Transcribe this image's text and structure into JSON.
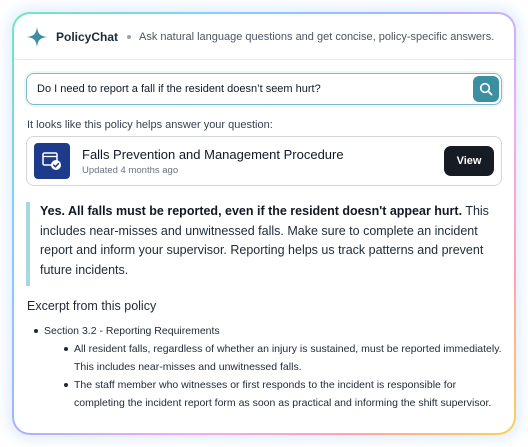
{
  "app": {
    "name": "PolicyChat",
    "tagline": "Ask natural language questions and get concise, policy-specific answers.",
    "logo_icon": "sparkle-icon",
    "colors": {
      "accent": "#3b8fa0",
      "doc_icon_bg": "#1e3a8a",
      "view_button_bg": "#171b24",
      "answer_bar": "#a5d8e0"
    }
  },
  "search": {
    "value": "Do I need to report a fall if the resident doesn’t seem hurt?",
    "button_icon": "search-icon"
  },
  "result": {
    "intro": "It looks like this policy helps answer your question:",
    "policy": {
      "icon": "document-check-icon",
      "title": "Falls Prevention and Management Procedure",
      "updated": "Updated 4 months ago",
      "view_label": "View"
    }
  },
  "answer": {
    "bold": "Yes. All falls must be reported, even if the resident doesn't appear hurt.",
    "text": "This includes near-misses and unwitnessed falls. Make sure to complete an incident report and inform your supervisor. Reporting helps us track patterns and prevent future incidents."
  },
  "excerpt": {
    "heading": "Excerpt from this policy",
    "section": "Section 3.2 - Reporting Requirements",
    "items": [
      "All resident falls, regardless of whether an injury is sustained, must be reported immediately. This includes near-misses and unwitnessed falls.",
      "The staff member who witnesses or first responds to the incident is responsible for completing the incident report form as soon as practical and informing the shift supervisor."
    ]
  }
}
